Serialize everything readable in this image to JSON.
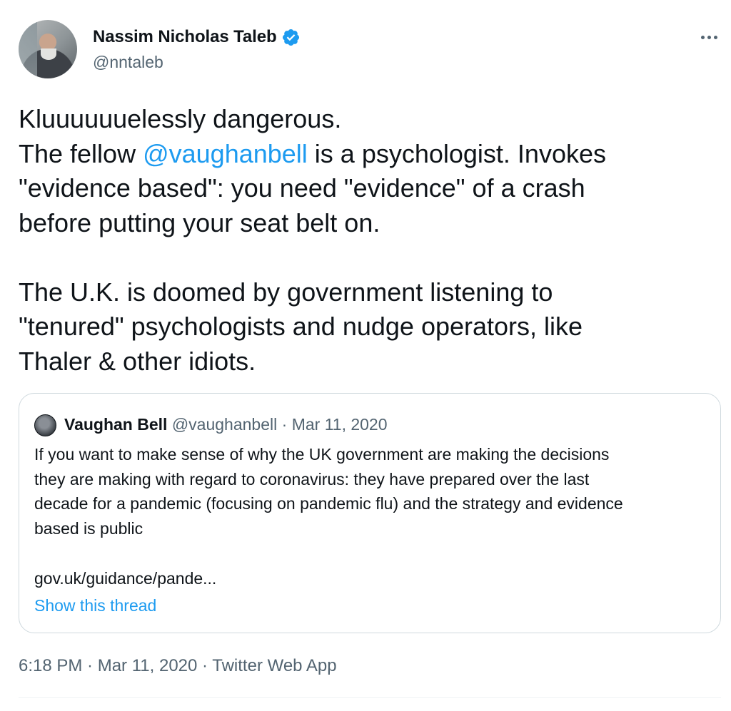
{
  "author": {
    "display_name": "Nassim Nicholas Taleb",
    "handle": "@nntaleb",
    "verified": true
  },
  "body": {
    "line1": "Kluuuuuuelessly dangerous.",
    "line2_prefix": "The fellow ",
    "mention": "@vaughanbell",
    "line2_suffix": " is a psychologist. Invokes\n\"evidence based\": you need \"evidence\" of a crash\nbefore putting your seat belt on.\n\nThe U.K. is doomed by government listening to\n\"tenured\" psychologists and nudge operators, like\nThaler & other idiots."
  },
  "quoted_tweet": {
    "display_name": "Vaughan Bell",
    "handle": "@vaughanbell",
    "separator": " · ",
    "date": "Mar 11, 2020",
    "text": "If you want to make sense of why the UK government are making the decisions\nthey are making with regard to coronavirus: they have prepared over the last\ndecade for a pandemic (focusing on pandemic flu) and the strategy and evidence\nbased is public",
    "link": "gov.uk/guidance/pande...",
    "show_thread": "Show this thread"
  },
  "footer": {
    "time": "6:18 PM",
    "separator": " · ",
    "date": "Mar 11, 2020",
    "source": "Twitter Web App"
  },
  "icons": {
    "verified": "verified-badge-icon",
    "more": "more-options-icon"
  },
  "colors": {
    "accent": "#1d9bf0",
    "text": "#0f1419",
    "secondary": "#536471",
    "border": "#cfd9de"
  }
}
